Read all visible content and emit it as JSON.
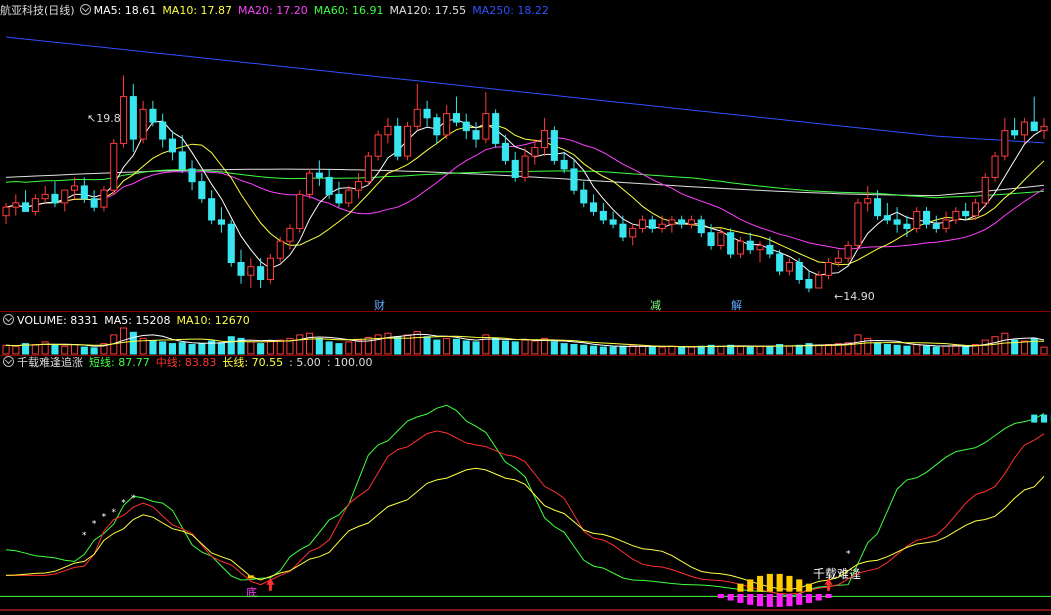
{
  "colors": {
    "background": "#000000",
    "separator": "#8b0000",
    "up": "#ff3b3b",
    "down": "#39e6f0",
    "ma5": "#ffffff",
    "ma10": "#ffff40",
    "ma20": "#ff40ff",
    "ma60": "#40ff40",
    "ma120": "#e0e0e0",
    "ma250": "#3050ff",
    "short_line": "#40ff40",
    "mid_line": "#ff3030",
    "long_line": "#ffff40"
  },
  "price_panel": {
    "title": "航亚科技(日线)",
    "indicators": [
      {
        "label": "MA5: 18.61",
        "color": "#ffffff"
      },
      {
        "label": "MA10: 17.87",
        "color": "#ffff40"
      },
      {
        "label": "MA20: 17.20",
        "color": "#ff40ff"
      },
      {
        "label": "MA60: 16.91",
        "color": "#40ff40"
      },
      {
        "label": "MA120: 17.55",
        "color": "#e0e0e0"
      },
      {
        "label": "MA250: 18.22",
        "color": "#3050ff"
      }
    ],
    "high_label": "19.89",
    "low_label": "14.90",
    "event_markers": [
      {
        "label": "财",
        "color": "#66aaff"
      },
      {
        "label": "减",
        "color": "#88ff88"
      },
      {
        "label": "解",
        "color": "#66aaff"
      }
    ],
    "y_range": [
      14.5,
      21.2
    ]
  },
  "volume_panel": {
    "indicators": [
      {
        "label": "VOLUME: 8331",
        "color": "#ffffff"
      },
      {
        "label": "MA5: 15208",
        "color": "#ffffff"
      },
      {
        "label": "MA10: 12670",
        "color": "#ffff40"
      }
    ]
  },
  "indicator_panel": {
    "name": "千载难逢追涨",
    "indicators": [
      {
        "label": "短线: 87.77",
        "color": "#40ff40"
      },
      {
        "label": "中线: 83.83",
        "color": "#ff3030"
      },
      {
        "label": "长线: 70.55",
        "color": "#ffff40"
      },
      {
        "label": ": 5.00",
        "color": "#dddddd"
      },
      {
        "label": ": 100.00",
        "color": "#dddddd"
      }
    ],
    "bottom_label": "底",
    "signal_label": "千载难逢"
  },
  "chart_data": {
    "type": "candlestick",
    "title": "航亚科技(日线)",
    "candles": [
      [
        16.6,
        16.9,
        16.4,
        16.8
      ],
      [
        16.8,
        17.1,
        16.6,
        16.9
      ],
      [
        16.9,
        17.2,
        16.7,
        16.7
      ],
      [
        16.7,
        17.1,
        16.6,
        17.0
      ],
      [
        17.0,
        17.3,
        16.9,
        17.1
      ],
      [
        17.1,
        17.4,
        16.8,
        16.9
      ],
      [
        16.9,
        17.2,
        16.7,
        17.2
      ],
      [
        17.2,
        17.5,
        17.0,
        17.3
      ],
      [
        17.3,
        17.5,
        16.9,
        17.0
      ],
      [
        17.0,
        17.2,
        16.7,
        16.8
      ],
      [
        16.8,
        17.3,
        16.7,
        17.2
      ],
      [
        17.2,
        18.4,
        17.1,
        18.3
      ],
      [
        18.3,
        19.9,
        18.2,
        19.4
      ],
      [
        19.4,
        19.7,
        18.1,
        18.4
      ],
      [
        18.4,
        19.3,
        18.3,
        19.1
      ],
      [
        19.1,
        19.3,
        18.7,
        18.8
      ],
      [
        18.8,
        19.0,
        18.2,
        18.4
      ],
      [
        18.4,
        18.6,
        17.9,
        18.1
      ],
      [
        18.1,
        18.5,
        17.6,
        17.7
      ],
      [
        17.7,
        17.9,
        17.2,
        17.4
      ],
      [
        17.4,
        17.6,
        16.9,
        17.0
      ],
      [
        17.0,
        17.2,
        16.4,
        16.5
      ],
      [
        16.5,
        16.8,
        16.2,
        16.4
      ],
      [
        16.4,
        16.5,
        15.4,
        15.5
      ],
      [
        15.5,
        15.8,
        15.0,
        15.2
      ],
      [
        15.2,
        15.6,
        14.9,
        15.4
      ],
      [
        15.4,
        15.6,
        14.9,
        15.1
      ],
      [
        15.1,
        15.7,
        15.0,
        15.6
      ],
      [
        15.6,
        16.1,
        15.5,
        16.0
      ],
      [
        16.0,
        16.4,
        15.8,
        16.3
      ],
      [
        16.3,
        17.2,
        16.2,
        17.1
      ],
      [
        17.1,
        17.7,
        17.0,
        17.6
      ],
      [
        17.6,
        17.9,
        17.3,
        17.5
      ],
      [
        17.5,
        17.7,
        17.0,
        17.1
      ],
      [
        17.1,
        17.4,
        16.8,
        16.9
      ],
      [
        16.9,
        17.3,
        16.8,
        17.2
      ],
      [
        17.2,
        17.6,
        17.0,
        17.4
      ],
      [
        17.4,
        18.1,
        17.3,
        18.0
      ],
      [
        18.0,
        18.6,
        17.9,
        18.5
      ],
      [
        18.5,
        18.9,
        18.3,
        18.7
      ],
      [
        18.7,
        18.9,
        17.9,
        18.0
      ],
      [
        18.0,
        18.8,
        17.9,
        18.7
      ],
      [
        18.7,
        19.7,
        18.6,
        19.1
      ],
      [
        19.1,
        19.3,
        18.7,
        18.9
      ],
      [
        18.9,
        19.0,
        18.3,
        18.5
      ],
      [
        18.5,
        19.2,
        18.4,
        19.0
      ],
      [
        19.0,
        19.4,
        18.7,
        18.8
      ],
      [
        18.8,
        19.0,
        18.4,
        18.6
      ],
      [
        18.6,
        18.8,
        18.2,
        18.4
      ],
      [
        18.4,
        19.5,
        18.3,
        19.0
      ],
      [
        19.0,
        19.1,
        18.2,
        18.3
      ],
      [
        18.3,
        18.5,
        17.8,
        17.9
      ],
      [
        17.9,
        18.1,
        17.4,
        17.5
      ],
      [
        17.5,
        18.2,
        17.4,
        18.0
      ],
      [
        18.0,
        18.4,
        17.8,
        18.2
      ],
      [
        18.2,
        18.9,
        18.0,
        18.6
      ],
      [
        18.6,
        18.7,
        17.8,
        17.9
      ],
      [
        17.9,
        18.1,
        17.6,
        17.7
      ],
      [
        17.7,
        17.9,
        17.1,
        17.2
      ],
      [
        17.2,
        17.4,
        16.8,
        16.9
      ],
      [
        16.9,
        17.1,
        16.6,
        16.7
      ],
      [
        16.7,
        16.9,
        16.4,
        16.5
      ],
      [
        16.5,
        16.7,
        16.3,
        16.4
      ],
      [
        16.4,
        16.6,
        16.0,
        16.1
      ],
      [
        16.1,
        16.4,
        15.9,
        16.3
      ],
      [
        16.3,
        16.6,
        16.2,
        16.5
      ],
      [
        16.5,
        16.6,
        16.2,
        16.3
      ],
      [
        16.3,
        16.6,
        16.2,
        16.4
      ],
      [
        16.4,
        16.6,
        16.2,
        16.5
      ],
      [
        16.5,
        16.6,
        16.3,
        16.4
      ],
      [
        16.4,
        16.6,
        16.3,
        16.5
      ],
      [
        16.5,
        16.6,
        16.1,
        16.2
      ],
      [
        16.2,
        16.4,
        15.8,
        15.9
      ],
      [
        15.9,
        16.3,
        15.8,
        16.2
      ],
      [
        16.2,
        16.3,
        15.6,
        15.7
      ],
      [
        15.7,
        16.1,
        15.6,
        16.0
      ],
      [
        16.0,
        16.2,
        15.7,
        15.8
      ],
      [
        15.8,
        16.0,
        15.5,
        15.9
      ],
      [
        15.9,
        16.1,
        15.6,
        15.7
      ],
      [
        15.7,
        15.8,
        15.2,
        15.3
      ],
      [
        15.3,
        15.6,
        15.2,
        15.5
      ],
      [
        15.5,
        15.6,
        15.0,
        15.1
      ],
      [
        15.1,
        15.3,
        14.8,
        14.9
      ],
      [
        14.9,
        15.3,
        14.9,
        15.2
      ],
      [
        15.2,
        15.6,
        15.1,
        15.5
      ],
      [
        15.5,
        15.8,
        15.4,
        15.6
      ],
      [
        15.6,
        16.0,
        15.5,
        15.9
      ],
      [
        15.9,
        17.0,
        15.8,
        16.9
      ],
      [
        16.9,
        17.3,
        16.7,
        17.0
      ],
      [
        17.0,
        17.2,
        16.5,
        16.6
      ],
      [
        16.6,
        16.9,
        16.4,
        16.5
      ],
      [
        16.5,
        16.8,
        16.2,
        16.4
      ],
      [
        16.4,
        16.6,
        16.1,
        16.3
      ],
      [
        16.3,
        16.8,
        16.2,
        16.7
      ],
      [
        16.7,
        16.8,
        16.3,
        16.4
      ],
      [
        16.4,
        16.6,
        16.2,
        16.3
      ],
      [
        16.3,
        16.7,
        16.2,
        16.5
      ],
      [
        16.5,
        16.8,
        16.4,
        16.7
      ],
      [
        16.7,
        16.9,
        16.5,
        16.6
      ],
      [
        16.6,
        17.0,
        16.5,
        16.9
      ],
      [
        16.9,
        17.6,
        16.8,
        17.5
      ],
      [
        17.5,
        18.1,
        17.4,
        18.0
      ],
      [
        18.0,
        18.9,
        17.9,
        18.6
      ],
      [
        18.6,
        18.9,
        18.4,
        18.5
      ],
      [
        18.5,
        18.9,
        18.3,
        18.8
      ],
      [
        18.8,
        19.4,
        18.6,
        18.6
      ],
      [
        18.6,
        18.9,
        18.4,
        18.7
      ]
    ],
    "volume": [
      10,
      9,
      12,
      11,
      14,
      10,
      9,
      11,
      8,
      7,
      12,
      22,
      30,
      25,
      18,
      15,
      14,
      12,
      13,
      11,
      12,
      15,
      13,
      20,
      18,
      14,
      12,
      15,
      16,
      18,
      22,
      24,
      18,
      14,
      12,
      14,
      16,
      19,
      22,
      24,
      20,
      22,
      26,
      20,
      16,
      18,
      17,
      15,
      14,
      22,
      18,
      15,
      14,
      16,
      15,
      18,
      14,
      12,
      11,
      10,
      9,
      8,
      8,
      9,
      10,
      9,
      8,
      8,
      9,
      8,
      8,
      9,
      10,
      9,
      10,
      9,
      8,
      9,
      9,
      11,
      9,
      10,
      12,
      10,
      11,
      12,
      13,
      22,
      18,
      13,
      11,
      10,
      9,
      11,
      9,
      8,
      9,
      10,
      9,
      11,
      16,
      20,
      24,
      16,
      15,
      18,
      8
    ]
  }
}
